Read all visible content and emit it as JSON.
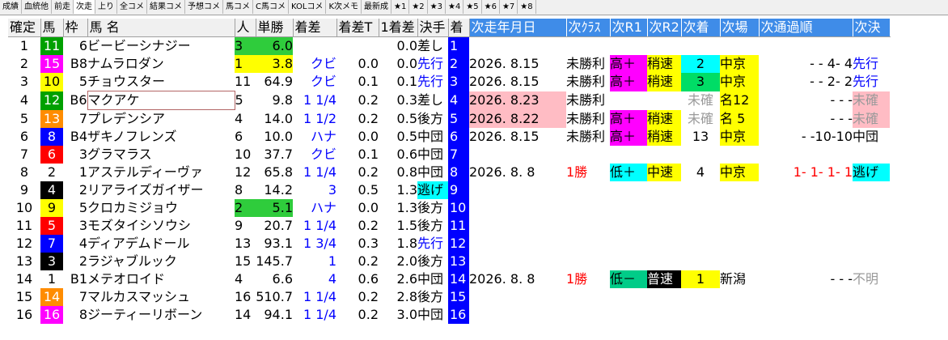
{
  "tabs": [
    "成績",
    "血統他",
    "前走",
    "次走",
    "上り",
    "全コメ",
    "結果コメ",
    "予想コメ",
    "馬コメ",
    "C馬コメ",
    "KOLコメ",
    "K次メモ",
    "最新成",
    "★1",
    "★2",
    "★3",
    "★4",
    "★5",
    "★6",
    "★7",
    "★8"
  ],
  "active_tab": 3,
  "columns": [
    "確定",
    "馬",
    "枠",
    "馬 名",
    "人",
    "単勝",
    "着差",
    "着差T",
    "1着差",
    "決手",
    "着",
    "次走年月日",
    "次ｸﾗｽ",
    "次R1",
    "次R2",
    "次着",
    "次場",
    "次通過順",
    "次決"
  ],
  "colors": {
    "header_bg": "#f0f0f0",
    "next_header_bg": "#3f8ce8",
    "finish_bg": "#0000ff",
    "waku": {
      "1": "#ffffff",
      "2": "#000000",
      "3": "#ff0000",
      "4": "#0000ff",
      "5": "#ffff00",
      "6": "#00a000",
      "7": "#ff8c00",
      "8": "#ff00ff"
    }
  },
  "rows": [
    {
      "kakutei": "1",
      "uma": "11",
      "waku": "6",
      "name": "ビービーシナジー",
      "ninki": "3",
      "tansho": "6.0",
      "chakusa": "",
      "chakusa_t": "",
      "first_sa": "0.0",
      "kimete": "差し",
      "chaku": "1",
      "next_date": "",
      "next_class": "",
      "next_r1": "",
      "next_r2": "",
      "next_chaku": "",
      "next_ba": "",
      "next_tsuka": "",
      "next_kime": ""
    },
    {
      "kakutei": "2",
      "uma": "15",
      "waku": "B8",
      "name": "ナムラロダン",
      "ninki": "1",
      "tansho": "3.8",
      "chakusa": "クビ",
      "chakusa_t": "0.0",
      "first_sa": "0.0",
      "kimete": "先行",
      "chaku": "2",
      "next_date": "2026. 8.15",
      "next_class": "未勝利",
      "next_r1": "高＋",
      "next_r2": "稍速",
      "next_chaku": "2",
      "next_ba": "中京",
      "next_tsuka": "-  - 4- 4",
      "next_kime": "先行"
    },
    {
      "kakutei": "3",
      "uma": "10",
      "waku": "5",
      "name": "チョウスター",
      "ninki": "11",
      "tansho": "64.9",
      "chakusa": "クビ",
      "chakusa_t": "0.1",
      "first_sa": "0.1",
      "kimete": "先行",
      "chaku": "3",
      "next_date": "2026. 8.15",
      "next_class": "未勝利",
      "next_r1": "高＋",
      "next_r2": "稍速",
      "next_chaku": "3",
      "next_ba": "中京",
      "next_tsuka": "-  - 2- 2",
      "next_kime": "先行"
    },
    {
      "kakutei": "4",
      "uma": "12",
      "waku": "B6",
      "name": "マクアケ",
      "ninki": "5",
      "tansho": "9.8",
      "chakusa": "1 1/4",
      "chakusa_t": "0.2",
      "first_sa": "0.3",
      "kimete": "差し",
      "chaku": "4",
      "next_date": "2026. 8.23",
      "next_class": "未勝利",
      "next_r1": "",
      "next_r2": "",
      "next_chaku": "未確",
      "next_ba": "名12",
      "next_tsuka": "-  -  -",
      "next_kime": "未確"
    },
    {
      "kakutei": "5",
      "uma": "13",
      "waku": "7",
      "name": "プレデンシア",
      "ninki": "4",
      "tansho": "14.0",
      "chakusa": "1 1/2",
      "chakusa_t": "0.2",
      "first_sa": "0.5",
      "kimete": "後方",
      "chaku": "5",
      "next_date": "2026. 8.22",
      "next_class": "未勝利",
      "next_r1": "高＋",
      "next_r2": "稍速",
      "next_chaku": "未確",
      "next_ba": "名 5",
      "next_tsuka": "-  -  -",
      "next_kime": "未確"
    },
    {
      "kakutei": "6",
      "uma": "8",
      "waku": "B4",
      "name": "ザキノフレンズ",
      "ninki": "6",
      "tansho": "10.0",
      "chakusa": "ハナ",
      "chakusa_t": "0.0",
      "first_sa": "0.5",
      "kimete": "中団",
      "chaku": "6",
      "next_date": "2026. 8.15",
      "next_class": "未勝利",
      "next_r1": "高＋",
      "next_r2": "稍速",
      "next_chaku": "13",
      "next_ba": "中京",
      "next_tsuka": "-  -10-10",
      "next_kime": "中団"
    },
    {
      "kakutei": "7",
      "uma": "6",
      "waku": "3",
      "name": "グラマラス",
      "ninki": "10",
      "tansho": "37.7",
      "chakusa": "クビ",
      "chakusa_t": "0.1",
      "first_sa": "0.6",
      "kimete": "中団",
      "chaku": "7",
      "next_date": "",
      "next_class": "",
      "next_r1": "",
      "next_r2": "",
      "next_chaku": "",
      "next_ba": "",
      "next_tsuka": "",
      "next_kime": ""
    },
    {
      "kakutei": "8",
      "uma": "2",
      "waku": "1",
      "name": "アステルディーヴァ",
      "ninki": "12",
      "tansho": "65.8",
      "chakusa": "1 1/4",
      "chakusa_t": "0.2",
      "first_sa": "0.8",
      "kimete": "中団",
      "chaku": "8",
      "next_date": "2026. 8. 8",
      "next_class": "1勝",
      "next_r1": "低＋",
      "next_r2": "中速",
      "next_chaku": "4",
      "next_ba": "中京",
      "next_tsuka": "1- 1- 1- 1",
      "next_kime": "逃げ"
    },
    {
      "kakutei": "9",
      "uma": "4",
      "waku": "2",
      "name": "リアライズガイザー",
      "ninki": "8",
      "tansho": "14.2",
      "chakusa": "3",
      "chakusa_t": "0.5",
      "first_sa": "1.3",
      "kimete": "逃げ",
      "chaku": "9",
      "next_date": "",
      "next_class": "",
      "next_r1": "",
      "next_r2": "",
      "next_chaku": "",
      "next_ba": "",
      "next_tsuka": "",
      "next_kime": ""
    },
    {
      "kakutei": "10",
      "uma": "9",
      "waku": "5",
      "name": "クロカミジョウ",
      "ninki": "2",
      "tansho": "5.1",
      "chakusa": "ハナ",
      "chakusa_t": "0.0",
      "first_sa": "1.3",
      "kimete": "後方",
      "chaku": "10",
      "next_date": "",
      "next_class": "",
      "next_r1": "",
      "next_r2": "",
      "next_chaku": "",
      "next_ba": "",
      "next_tsuka": "",
      "next_kime": ""
    },
    {
      "kakutei": "11",
      "uma": "5",
      "waku": "3",
      "name": "モズタイシソウシ",
      "ninki": "9",
      "tansho": "20.7",
      "chakusa": "1 1/4",
      "chakusa_t": "0.2",
      "first_sa": "1.5",
      "kimete": "後方",
      "chaku": "11",
      "next_date": "",
      "next_class": "",
      "next_r1": "",
      "next_r2": "",
      "next_chaku": "",
      "next_ba": "",
      "next_tsuka": "",
      "next_kime": ""
    },
    {
      "kakutei": "12",
      "uma": "7",
      "waku": "4",
      "name": "ディアデムドール",
      "ninki": "13",
      "tansho": "93.1",
      "chakusa": "1 3/4",
      "chakusa_t": "0.3",
      "first_sa": "1.8",
      "kimete": "先行",
      "chaku": "12",
      "next_date": "",
      "next_class": "",
      "next_r1": "",
      "next_r2": "",
      "next_chaku": "",
      "next_ba": "",
      "next_tsuka": "",
      "next_kime": ""
    },
    {
      "kakutei": "13",
      "uma": "3",
      "waku": "2",
      "name": "ラジャブルック",
      "ninki": "15",
      "tansho": "145.7",
      "chakusa": "1",
      "chakusa_t": "0.2",
      "first_sa": "2.0",
      "kimete": "後方",
      "chaku": "13",
      "next_date": "",
      "next_class": "",
      "next_r1": "",
      "next_r2": "",
      "next_chaku": "",
      "next_ba": "",
      "next_tsuka": "",
      "next_kime": ""
    },
    {
      "kakutei": "14",
      "uma": "1",
      "waku": "B1",
      "name": "メテオロイド",
      "ninki": "4",
      "tansho": "6.6",
      "chakusa": "4",
      "chakusa_t": "0.6",
      "first_sa": "2.6",
      "kimete": "中団",
      "chaku": "14",
      "next_date": "2026. 8. 8",
      "next_class": "1勝",
      "next_r1": "低－",
      "next_r2": "普速",
      "next_chaku": "1",
      "next_ba": "新潟",
      "next_tsuka": "-  -  -",
      "next_kime": "不明"
    },
    {
      "kakutei": "15",
      "uma": "14",
      "waku": "7",
      "name": "マルカスマッシュ",
      "ninki": "16",
      "tansho": "510.7",
      "chakusa": "1 1/4",
      "chakusa_t": "0.2",
      "first_sa": "2.8",
      "kimete": "後方",
      "chaku": "15",
      "next_date": "",
      "next_class": "",
      "next_r1": "",
      "next_r2": "",
      "next_chaku": "",
      "next_ba": "",
      "next_tsuka": "",
      "next_kime": ""
    },
    {
      "kakutei": "16",
      "uma": "16",
      "waku": "8",
      "name": "ジーティーリボーン",
      "ninki": "14",
      "tansho": "94.1",
      "chakusa": "1 1/4",
      "chakusa_t": "0.2",
      "first_sa": "3.0",
      "kimete": "中団",
      "chaku": "16",
      "next_date": "",
      "next_class": "",
      "next_r1": "",
      "next_r2": "",
      "next_chaku": "",
      "next_ba": "",
      "next_tsuka": "",
      "next_kime": ""
    }
  ]
}
